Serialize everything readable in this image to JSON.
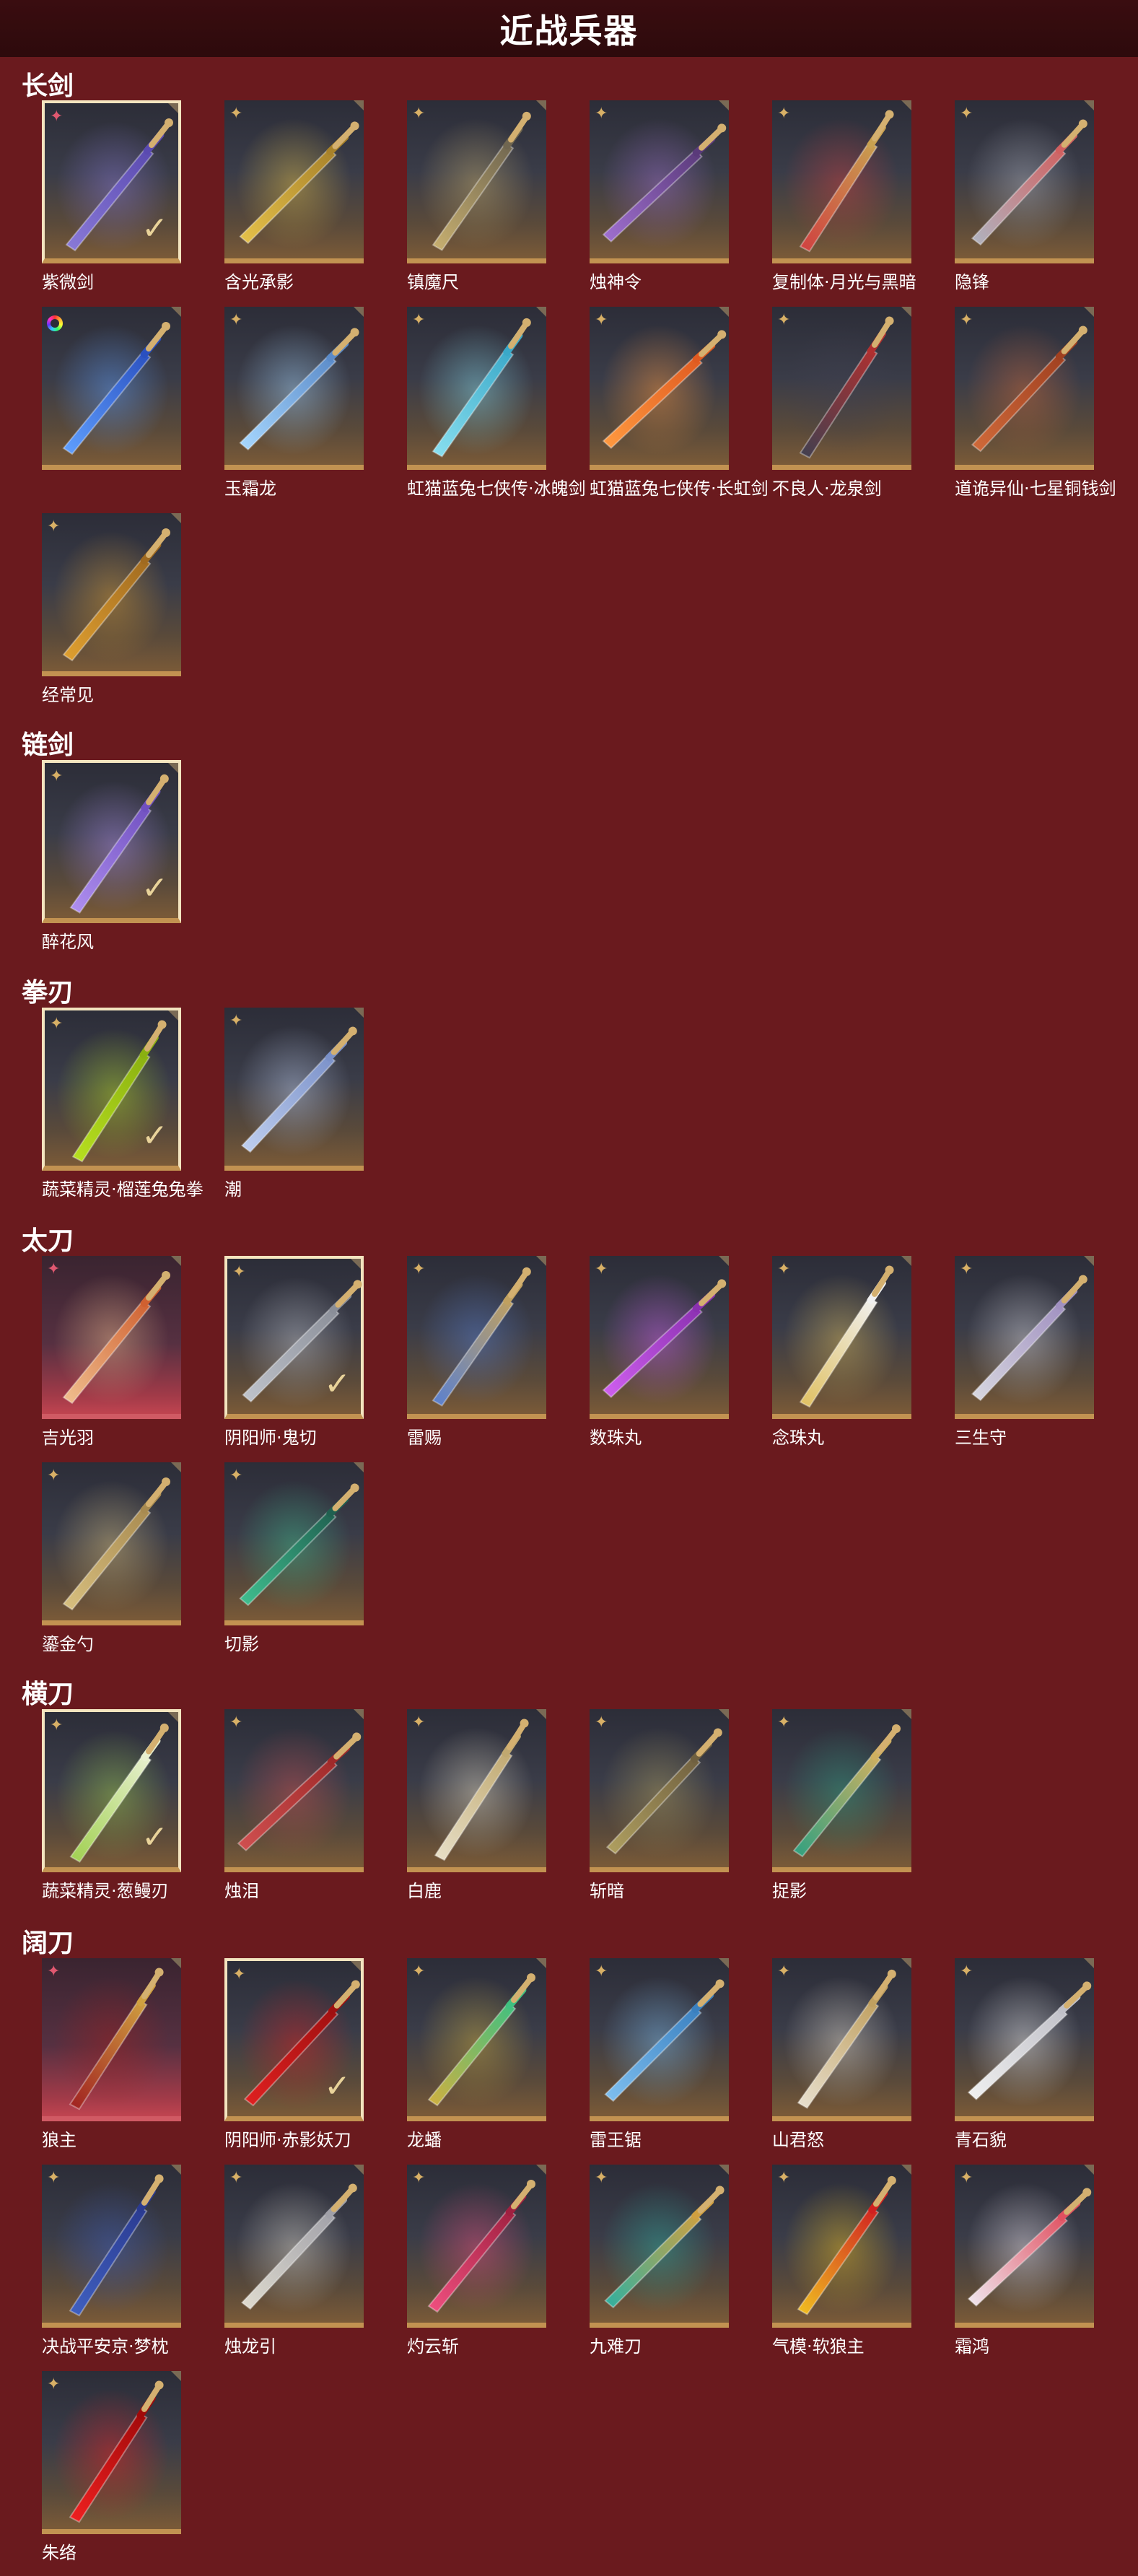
{
  "page_title": "近战兵器",
  "sections": [
    {
      "title": "长剑",
      "items": [
        {
          "name": "紫微剑",
          "badge": "star-red",
          "selected": true,
          "red": false,
          "w1": "#8a7ad8",
          "w2": "#5a4ab0"
        },
        {
          "name": "含光承影",
          "badge": "star",
          "w1": "#e6c24a",
          "w2": "#a8822a"
        },
        {
          "name": "镇魔尺",
          "badge": "star",
          "w1": "#c8b070",
          "w2": "#706650"
        },
        {
          "name": "烛神令",
          "badge": "star",
          "w1": "#a070d0",
          "w2": "#5a3a7a"
        },
        {
          "name": "复制体·月光与黑暗",
          "badge": "star",
          "w1": "#d04040",
          "w2": "#c8a050"
        },
        {
          "name": "隐锋",
          "badge": "star",
          "w1": "#b0b4c0",
          "w2": "#d06060"
        },
        {
          "name": "",
          "badge": "ring",
          "w1": "#60a0ff",
          "w2": "#2a50c0"
        },
        {
          "name": "玉霜龙",
          "badge": "star",
          "w1": "#a8d8ff",
          "w2": "#5a8ac8"
        },
        {
          "name": "虹猫蓝兔七侠传·冰魄剑",
          "badge": "star",
          "w1": "#8ae0f0",
          "w2": "#3aa8c8"
        },
        {
          "name": "虹猫蓝兔七侠传·长虹剑",
          "badge": "star",
          "w1": "#ff9a40",
          "w2": "#e05a20"
        },
        {
          "name": "不良人·龙泉剑",
          "badge": "star",
          "w1": "#404050",
          "w2": "#b03030"
        },
        {
          "name": "道诡异仙·七星铜钱剑",
          "badge": "star",
          "w1": "#d06a3a",
          "w2": "#a04020"
        },
        {
          "name": "经常见",
          "badge": "star",
          "w1": "#e0a030",
          "w2": "#a06a20"
        }
      ]
    },
    {
      "title": "链剑",
      "items": [
        {
          "name": "醉花风",
          "badge": "star",
          "selected": true,
          "w1": "#b090f0",
          "w2": "#7050c0"
        }
      ]
    },
    {
      "title": "拳刃",
      "items": [
        {
          "name": "蔬菜精灵·榴莲兔兔拳",
          "badge": "star",
          "selected": true,
          "w1": "#b8e020",
          "w2": "#8ab010"
        },
        {
          "name": "潮",
          "badge": "star",
          "w1": "#c0d0f0",
          "w2": "#7a90c8"
        }
      ]
    },
    {
      "title": "太刀",
      "items": [
        {
          "name": "吉光羽",
          "badge": "star-red",
          "red": true,
          "w1": "#f0c090",
          "w2": "#d06030"
        },
        {
          "name": "阴阳师·鬼切",
          "badge": "star",
          "selected": true,
          "w1": "#c0c4cc",
          "w2": "#8a8e98"
        },
        {
          "name": "雷赐",
          "badge": "star",
          "w1": "#5a80d0",
          "w2": "#c0a060"
        },
        {
          "name": "数珠丸",
          "badge": "star",
          "w1": "#d060f0",
          "w2": "#8a30b0"
        },
        {
          "name": "念珠丸",
          "badge": "star",
          "w1": "#e0c060",
          "w2": "#f0f0f0"
        },
        {
          "name": "三生守",
          "badge": "star",
          "w1": "#d8d8e0",
          "w2": "#a090c0"
        },
        {
          "name": "鎏金勺",
          "badge": "star",
          "w1": "#d8c080",
          "w2": "#a88a50"
        },
        {
          "name": "切影",
          "badge": "star",
          "w1": "#40c090",
          "w2": "#206050"
        }
      ]
    },
    {
      "title": "横刀",
      "items": [
        {
          "name": "蔬菜精灵·葱鳗刃",
          "badge": "star",
          "selected": true,
          "w1": "#a0d050",
          "w2": "#e8f0d0"
        },
        {
          "name": "烛泪",
          "badge": "star",
          "w1": "#d05050",
          "w2": "#a02a2a"
        },
        {
          "name": "白鹿",
          "badge": "star",
          "w1": "#e8e0c8",
          "w2": "#c0a870"
        },
        {
          "name": "斩暗",
          "badge": "star",
          "w1": "#b0a060",
          "w2": "#706040"
        },
        {
          "name": "捉影",
          "badge": "star",
          "w1": "#30a080",
          "w2": "#d0b060"
        }
      ]
    },
    {
      "title": "阔刀",
      "items": [
        {
          "name": "狼主",
          "badge": "star-red",
          "red": true,
          "w1": "#a02020",
          "w2": "#d0a040"
        },
        {
          "name": "阴阳师·赤影妖刀",
          "badge": "star",
          "selected": true,
          "w1": "#e02020",
          "w2": "#a01010"
        },
        {
          "name": "龙蟠",
          "badge": "star",
          "w1": "#d0b040",
          "w2": "#40c080"
        },
        {
          "name": "雷王锯",
          "badge": "star",
          "w1": "#80c0f0",
          "w2": "#3a80c0"
        },
        {
          "name": "山君怒",
          "badge": "star",
          "w1": "#e8e0d0",
          "w2": "#c0a060"
        },
        {
          "name": "青石貌",
          "badge": "star",
          "w1": "#f0f0f0",
          "w2": "#c0c0c8"
        },
        {
          "name": "决战平安京·梦枕",
          "badge": "star",
          "w1": "#4060c0",
          "w2": "#2a3a90"
        },
        {
          "name": "烛龙引",
          "badge": "star",
          "w1": "#e0dcd0",
          "w2": "#a0a0a8"
        },
        {
          "name": "灼云斩",
          "badge": "star",
          "w1": "#f05080",
          "w2": "#a02040"
        },
        {
          "name": "九难刀",
          "badge": "star",
          "w1": "#30b0a0",
          "w2": "#d0a040"
        },
        {
          "name": "气模·软狼主",
          "badge": "star",
          "w1": "#f0c020",
          "w2": "#d02020"
        },
        {
          "name": "霜鸿",
          "badge": "star",
          "w1": "#f0e8f0",
          "w2": "#e05060"
        },
        {
          "name": "朱络",
          "badge": "star",
          "w1": "#f02020",
          "w2": "#a00a0a"
        }
      ]
    }
  ]
}
